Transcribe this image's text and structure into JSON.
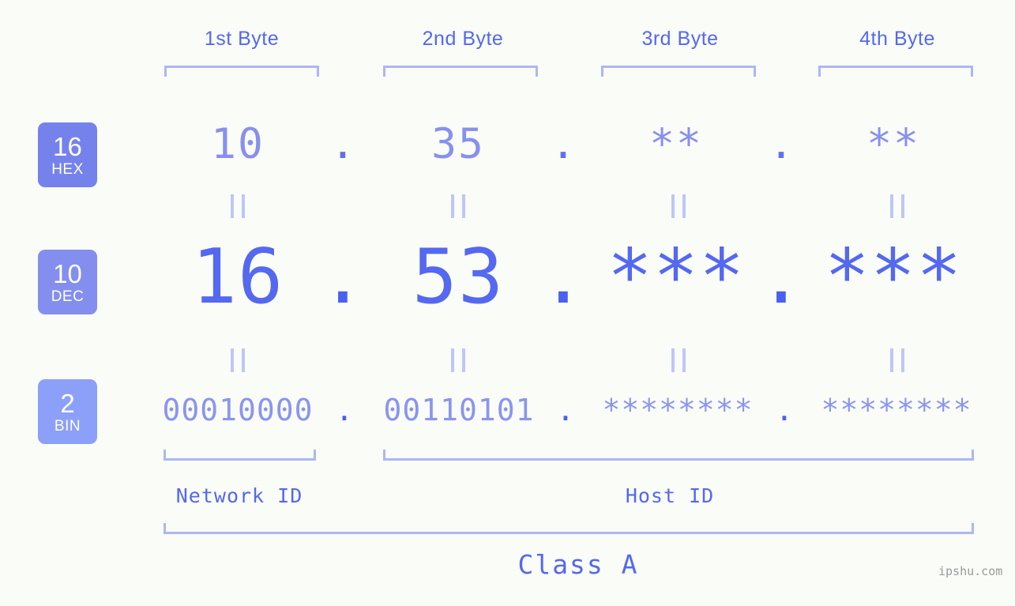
{
  "meta": {
    "background_color": "#FAFCF7",
    "accent_color": "#5468F0",
    "bracket_color": "#AEB6F5",
    "watermark": "ipshu.com"
  },
  "byte_headers": [
    {
      "label": "1st Byte"
    },
    {
      "label": "2nd Byte"
    },
    {
      "label": "3rd Byte"
    },
    {
      "label": "4th Byte"
    }
  ],
  "rows": [
    {
      "badge_num": "16",
      "badge_name": "HEX",
      "badge_color": "#7582EC",
      "text_color": "#8890EE",
      "values": [
        "10",
        "35",
        "**",
        "**"
      ],
      "separator": "."
    },
    {
      "badge_num": "10",
      "badge_name": "DEC",
      "badge_color": "#838EEE",
      "text_color": "#5468F0",
      "values": [
        "16",
        "53",
        "***",
        "***"
      ],
      "separator": "."
    },
    {
      "badge_num": "2",
      "badge_name": "BIN",
      "badge_color": "#8CA0FA",
      "text_color": "#8A95EE",
      "values": [
        "00010000",
        "00110101",
        "********",
        "********"
      ],
      "separator": "."
    }
  ],
  "equals_marks": {
    "glyph": "||",
    "count_per_gap": 4
  },
  "segments": {
    "network_id": "Network ID",
    "host_id": "Host ID",
    "class": "Class A"
  }
}
